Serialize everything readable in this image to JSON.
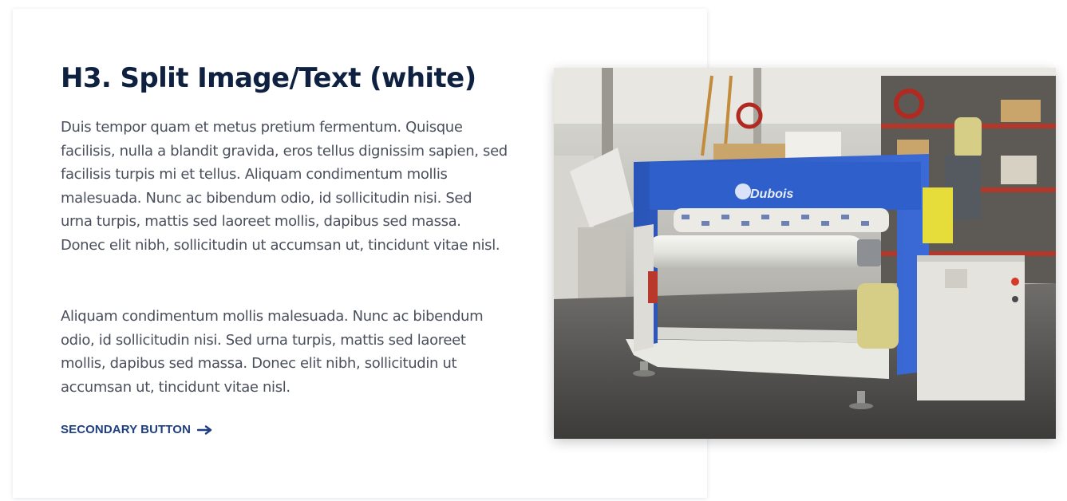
{
  "section": {
    "heading": "H3. Split Image/Text (white)",
    "paragraphs": [
      "Duis tempor quam et metus pretium fermentum. Quisque facilisis, nulla a blandit gravida, eros tellus dignissim sapien, sed facilisis turpis mi et tellus. Aliquam condimentum mollis malesuada. Nunc ac bibendum odio, id sollicitudin nisi. Sed urna turpis, mattis sed laoreet mollis, dapibus sed massa. Donec elit nibh, sollicitudin ut accumsan ut, tincidunt vitae nisl.",
      "Aliquam condimentum mollis malesuada. Nunc ac bibendum odio, id sollicitudin nisi. Sed urna turpis, mattis sed laoreet mollis, dapibus sed massa. Donec elit nibh, sollicitudin ut accumsan ut, tincidunt vitae nisl."
    ],
    "button": {
      "label": "SECONDARY BUTTON",
      "icon": "arrow-right-icon"
    }
  },
  "photo": {
    "machine_logo": "Dubois"
  },
  "colors": {
    "heading": "#0f2140",
    "body_text": "#4a4f5c",
    "button": "#1e3f83",
    "machine_blue": "#2d5cc4"
  }
}
